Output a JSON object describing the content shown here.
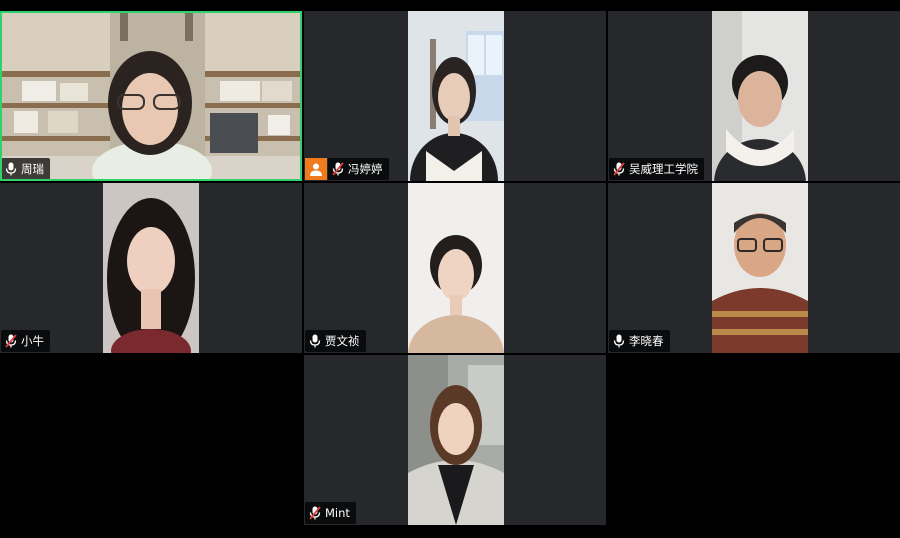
{
  "participants": [
    {
      "name": "周瑞",
      "mic": "on",
      "active": true
    },
    {
      "name": "冯婷婷",
      "mic": "muted",
      "avatar_badge": true
    },
    {
      "name": "吴威理工学院",
      "mic": "muted"
    },
    {
      "name": "小牛",
      "mic": "muted"
    },
    {
      "name": "贾文祯",
      "mic": "on"
    },
    {
      "name": "李晓春",
      "mic": "on"
    },
    {
      "name": "Mint",
      "mic": "muted"
    }
  ],
  "colors": {
    "active_border": "#2fd16a",
    "muted_icon": "#e03b3b",
    "avatar_badge": "#f07b1f",
    "tile_bg": "#26282b"
  },
  "icons": {
    "mic_on": "microphone-icon",
    "mic_muted": "microphone-muted-icon",
    "avatar": "person-icon"
  }
}
